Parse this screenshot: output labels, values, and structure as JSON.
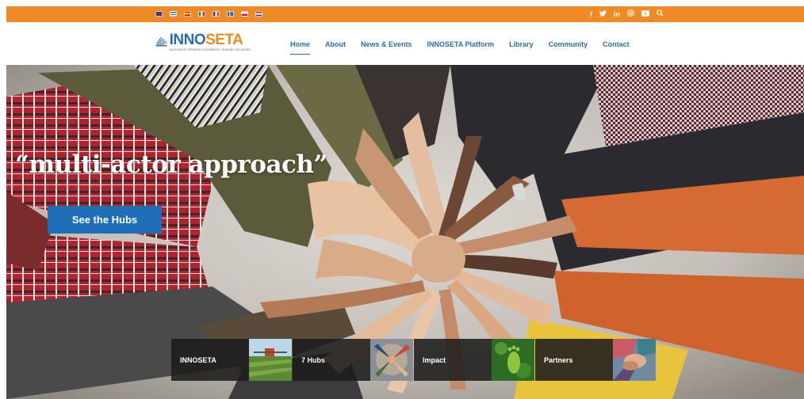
{
  "topbar": {
    "background": "#f08a24",
    "languages": [
      {
        "icon": "flag-uk-icon",
        "colors": [
          "#1f3f8f",
          "#c8102e"
        ]
      },
      {
        "icon": "flag-greece-icon",
        "colors": [
          "#2f66c2",
          "#ffffff"
        ]
      },
      {
        "icon": "flag-spain-icon",
        "colors": [
          "#c60b1e",
          "#ffc400"
        ]
      },
      {
        "icon": "flag-italy-icon",
        "colors": [
          "#1e9a4f",
          "#ce2b37"
        ]
      },
      {
        "icon": "flag-france-icon",
        "colors": [
          "#1f3f8f",
          "#ef4135"
        ]
      },
      {
        "icon": "flag-sweden-icon",
        "colors": [
          "#2f66c2",
          "#f6c900"
        ]
      },
      {
        "icon": "flag-poland-icon",
        "colors": [
          "#ffffff",
          "#dc143c"
        ]
      },
      {
        "icon": "flag-netherlands-icon",
        "colors": [
          "#ae1c28",
          "#21468b"
        ]
      }
    ],
    "socials": [
      {
        "icon": "facebook-icon",
        "glyph": "f"
      },
      {
        "icon": "twitter-icon",
        "glyph": "🐦"
      },
      {
        "icon": "linkedin-icon",
        "glyph": "in"
      },
      {
        "icon": "instagram-icon",
        "glyph": "◎"
      },
      {
        "icon": "youtube-icon",
        "glyph": "▶"
      },
      {
        "icon": "search-icon",
        "glyph": "⌕"
      }
    ]
  },
  "logo": {
    "part1": "INNO",
    "part2": "SETA",
    "tagline": "INNOVATIVE SPRAYING EQUIPMENT TRAINING ADVISORS",
    "colors": {
      "blue": "#2b6cb3",
      "orange": "#f08a24"
    }
  },
  "nav": {
    "items": [
      {
        "label": "Home",
        "active": true
      },
      {
        "label": "About",
        "active": false
      },
      {
        "label": "News & Events",
        "active": false
      },
      {
        "label": "INNOSETA Platform",
        "active": false
      },
      {
        "label": "Library",
        "active": false
      },
      {
        "label": "Community",
        "active": false
      },
      {
        "label": "Contact",
        "active": false
      }
    ],
    "color": "#2b6cb3"
  },
  "hero": {
    "quote": "“multi-actor approach”",
    "button_label": "See the Hubs",
    "button_color": "#1e6fb8",
    "image": "hands-stacked-together-photo"
  },
  "tiles": [
    {
      "label": "INNOSETA",
      "thumb": "sprayer-field-thumbnail"
    },
    {
      "label": "7 Hubs",
      "thumb": "hands-circle-thumbnail"
    },
    {
      "label": "Impact",
      "thumb": "green-leaf-footprint-thumbnail"
    },
    {
      "label": "Partners",
      "thumb": "hands-together-thumbnail"
    }
  ]
}
